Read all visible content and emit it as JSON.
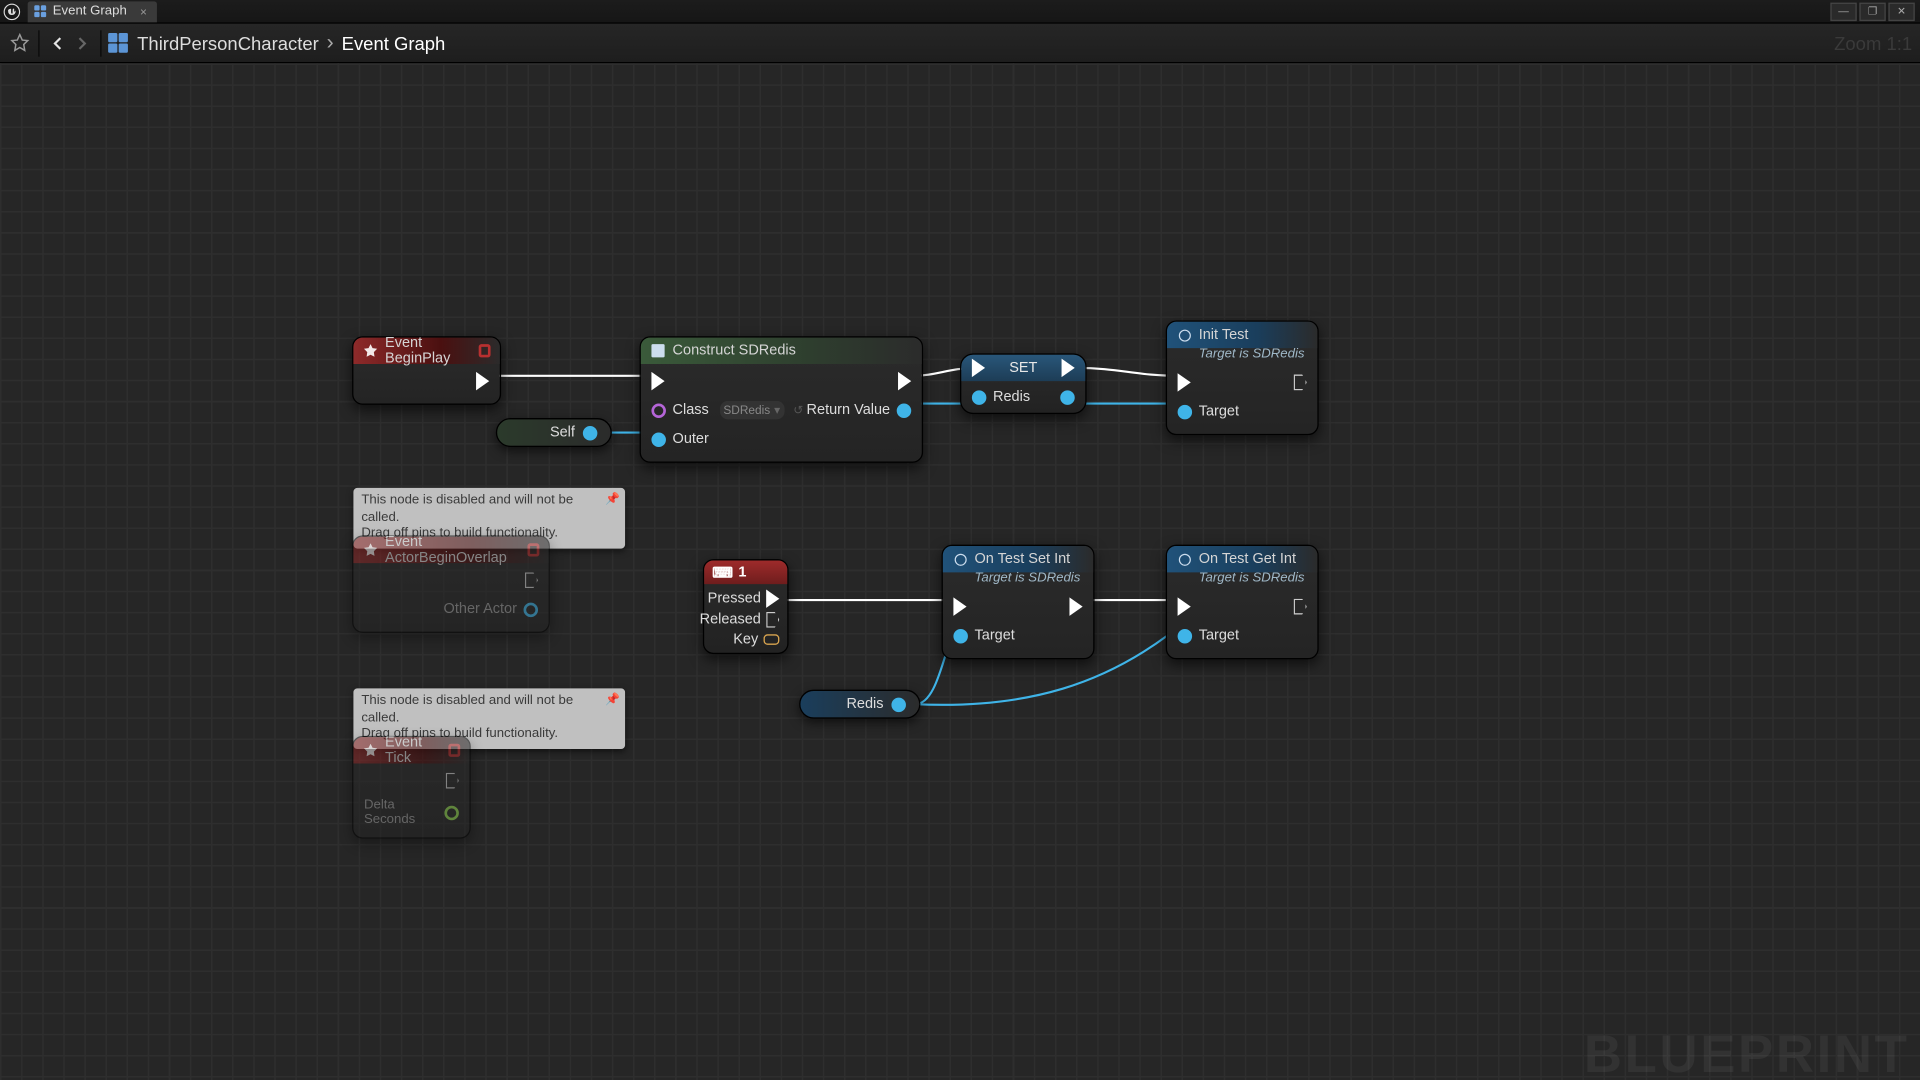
{
  "window": {
    "tab_label": "Event Graph"
  },
  "toolbar": {
    "crumb1": "ThirdPersonCharacter",
    "crumb2": "Event Graph",
    "zoom": "Zoom 1:1"
  },
  "watermark": "BLUEPRINT",
  "notes": {
    "disabled_line1": "This node is disabled and will not be called.",
    "disabled_line2": "Drag off pins to build functionality."
  },
  "nodes": {
    "event_begin_play": {
      "title": "Event BeginPlay"
    },
    "construct": {
      "title": "Construct SDRedis",
      "class_label": "Class",
      "class_value": "SDRedis",
      "outer_label": "Outer",
      "return_label": "Return Value"
    },
    "set": {
      "title": "SET",
      "in_label": "Redis"
    },
    "init_test": {
      "title": "Init Test",
      "subtitle": "Target is SDRedis",
      "target": "Target"
    },
    "self_var": {
      "label": "Self"
    },
    "actor_overlap": {
      "title": "Event ActorBeginOverlap",
      "out": "Other Actor"
    },
    "key": {
      "key": "1",
      "pressed": "Pressed",
      "released": "Released",
      "keylabel": "Key"
    },
    "on_set_int": {
      "title": "On Test Set Int",
      "subtitle": "Target is SDRedis",
      "target": "Target"
    },
    "on_get_int": {
      "title": "On Test Get Int",
      "subtitle": "Target is SDRedis",
      "target": "Target"
    },
    "redis_var": {
      "label": "Redis"
    },
    "event_tick": {
      "title": "Event Tick",
      "out": "Delta Seconds"
    }
  }
}
